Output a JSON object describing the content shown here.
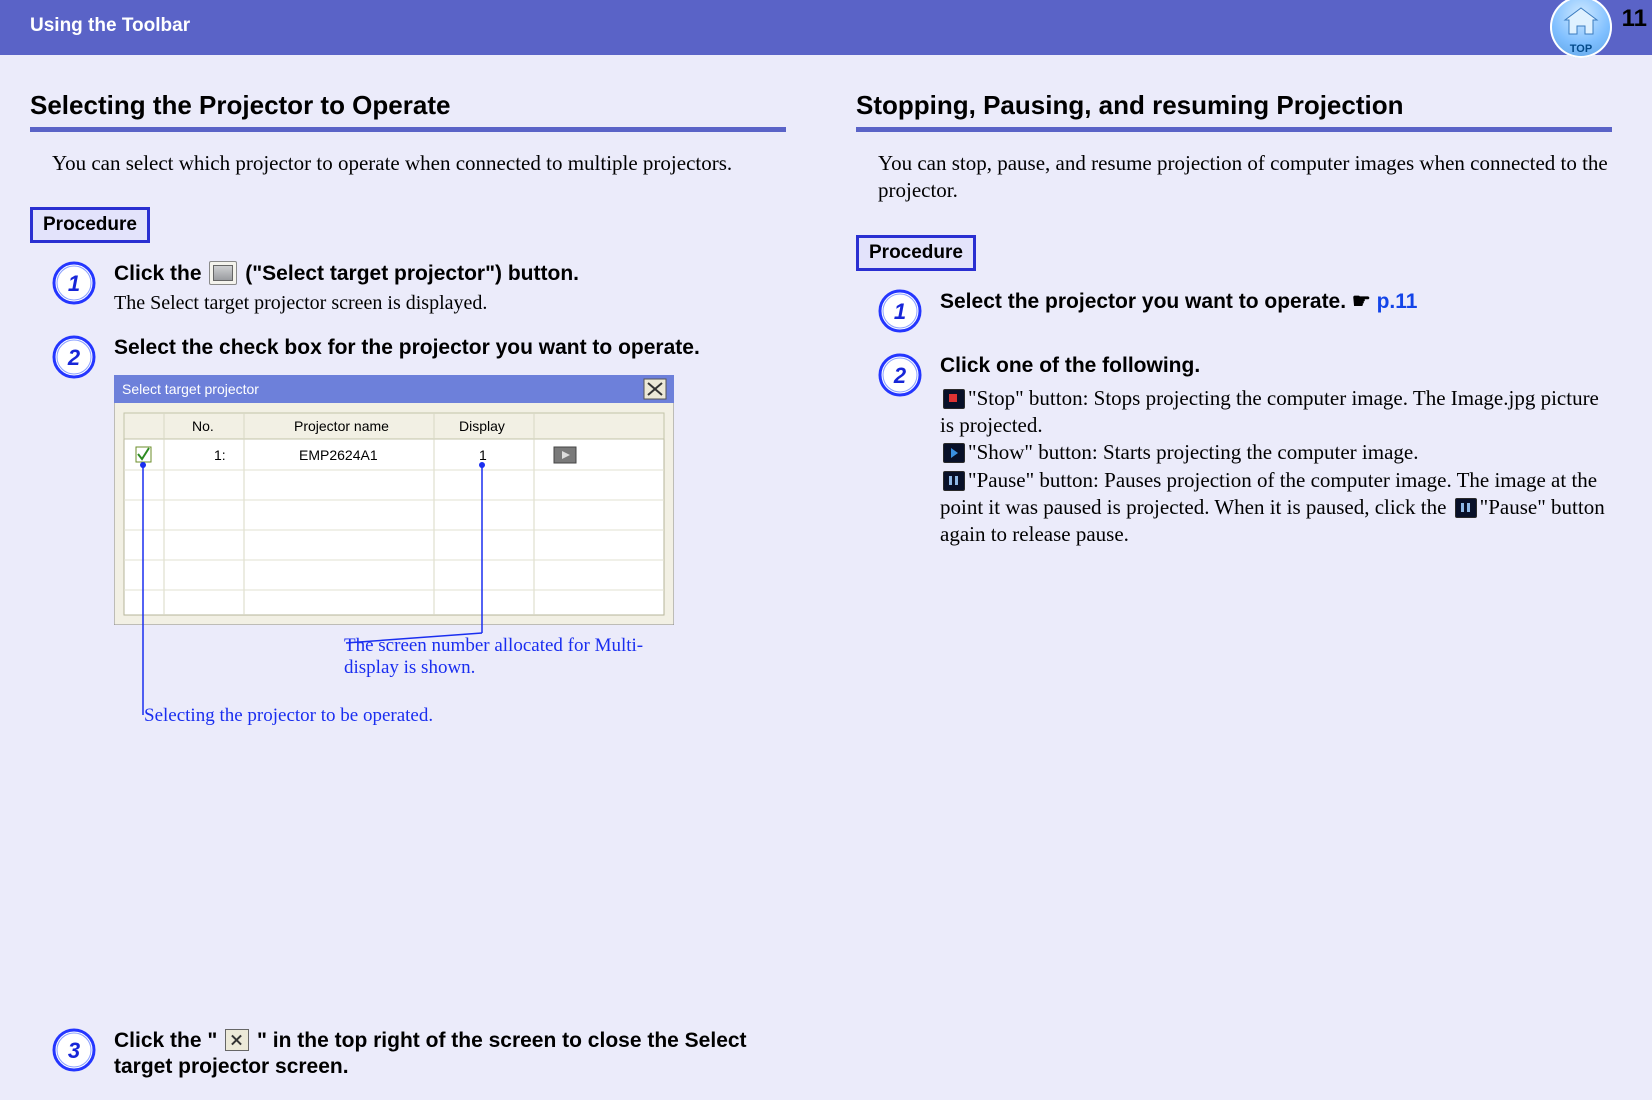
{
  "header": {
    "title": "Using the Toolbar",
    "page_number": "11",
    "top_icon_label": "TOP"
  },
  "left": {
    "heading": "Selecting the Projector to Operate",
    "intro": "You can select which projector to operate when connected to multiple projectors.",
    "procedure_label": "Procedure",
    "steps": {
      "s1": {
        "num": "1",
        "title_before": "Click the ",
        "title_after": " (\"Select target projector\") button.",
        "sub": "The Select target projector screen is displayed."
      },
      "s2": {
        "num": "2",
        "title": "Select the check box for the projector you want to operate."
      },
      "s3": {
        "num": "3",
        "title_before": "Click the \"",
        "title_after": "\" in the top right of the screen to close the Select target projector screen."
      }
    },
    "dialog": {
      "title": "Select target projector",
      "columns": {
        "c1": "No.",
        "c2": "Projector name",
        "c3": "Display"
      },
      "row": {
        "no": "1:",
        "name": "EMP2624A1",
        "display": "1"
      }
    },
    "callouts": {
      "display_note": "The screen number allocated for Multi-display is shown.",
      "select_note": "Selecting the projector to be operated."
    }
  },
  "right": {
    "heading": "Stopping, Pausing, and resuming Projection",
    "intro": "You can stop, pause, and resume projection of computer images when connected to the projector.",
    "procedure_label": "Procedure",
    "steps": {
      "s1": {
        "num": "1",
        "title": "Select the projector you want to operate. ",
        "pointer": "☛",
        "link": "p.11"
      },
      "s2": {
        "num": "2",
        "title": "Click one of the following.",
        "stop_label": "\"Stop\" button: Stops projecting the computer image. The Image.jpg picture is projected.",
        "show_label": "\"Show\" button: Starts projecting the computer image.",
        "pause_label_a": "\"Pause\" button: Pauses projection of the computer image. The image at the point it was paused is projected. When it is paused, click the ",
        "pause_label_b": "\"Pause\" button again to release pause."
      }
    }
  }
}
